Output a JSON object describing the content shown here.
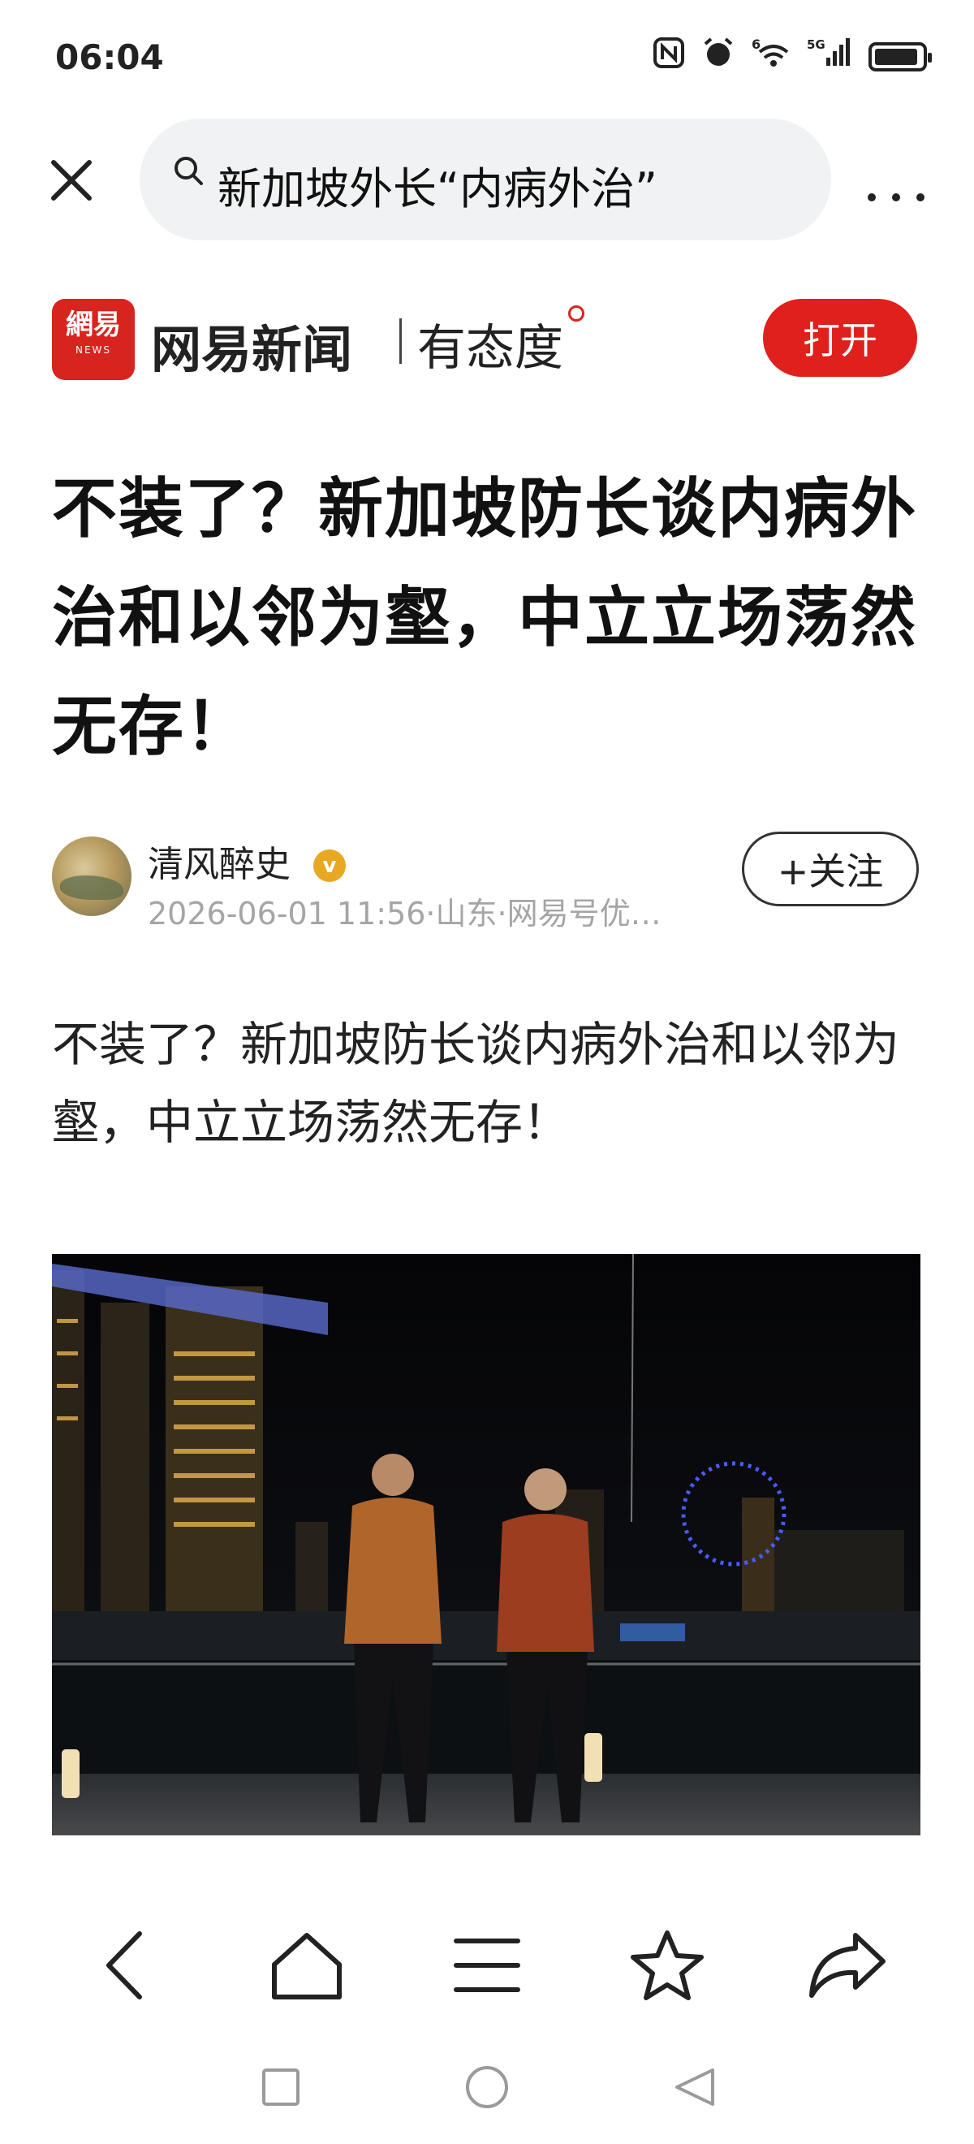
{
  "status_bar": {
    "time": "06:04",
    "icons": [
      "nfc-icon",
      "alarm-icon",
      "wifi-icon",
      "signal-5g-icon",
      "battery-icon"
    ],
    "network_label": "5G",
    "wifi_label": "6"
  },
  "search": {
    "query": "新加坡外长“内病外治”"
  },
  "brand": {
    "logo_text": "網易",
    "logo_sub": "NEWS",
    "name": "网易新闻",
    "slogan": "有态度",
    "open_label": "打开",
    "accent_color": "#e0201c"
  },
  "article": {
    "headline": "不装了？新加坡防长谈内病外治和以邻为壑，中立立场荡然无存！",
    "author_name": "清风醉史",
    "author_meta": "2026-06-01 11:56·山东·网易号优…",
    "follow_label": "+关注",
    "body": "不装了？新加坡防长谈内病外治和以邻为壑，中立立场荡然无存！"
  },
  "bottom_nav": [
    "back-icon",
    "home-icon",
    "menu-icon",
    "star-icon",
    "share-icon"
  ],
  "system_nav": [
    "recent-apps-icon",
    "home-circle-icon",
    "back-triangle-icon"
  ]
}
